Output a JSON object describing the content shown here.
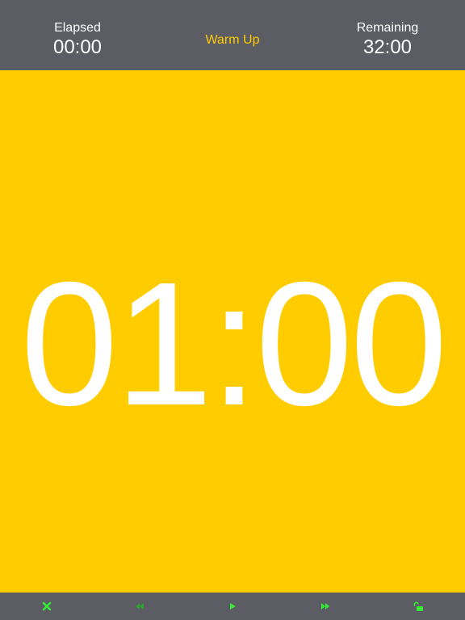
{
  "header": {
    "elapsed_label": "Elapsed",
    "elapsed_value": "00:00",
    "phase": "Warm Up",
    "remaining_label": "Remaining",
    "remaining_value": "32:00"
  },
  "timer": {
    "countdown": "01:00"
  },
  "controls": [
    {
      "icon": "close-icon",
      "color": "#33ee33"
    },
    {
      "icon": "rewind-icon",
      "color": "#2aa52a"
    },
    {
      "icon": "play-icon",
      "color": "#33ee33"
    },
    {
      "icon": "fast-forward-icon",
      "color": "#33ee33"
    },
    {
      "icon": "unlock-icon",
      "color": "#33ee33"
    }
  ],
  "colors": {
    "bar_background": "#5b5c64",
    "phase_background": "#ffcc00",
    "text": "#ffffff",
    "phase_text": "#ffcc00",
    "control_active": "#33ee33",
    "control_dim": "#2aa52a"
  }
}
